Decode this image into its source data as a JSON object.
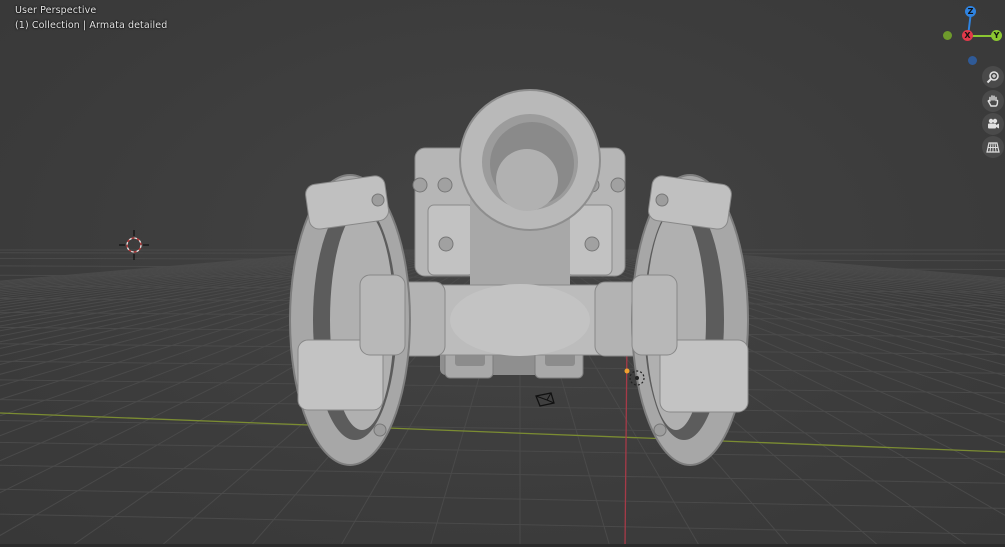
{
  "viewport": {
    "perspective_label": "User Perspective",
    "collection_label": "(1) Collection | Armata detailed"
  },
  "gizmo": {
    "x_label": "X",
    "y_label": "Y",
    "z_label": "Z",
    "colors": {
      "x": "#e0394a",
      "y": "#8bc631",
      "z": "#2f83e0",
      "neg_x": "#7a3a3f",
      "neg_y": "#6e9a2c",
      "neg_z": "#2f5a97"
    }
  },
  "nav_buttons": {
    "zoom_icon": "zoom-icon",
    "pan_icon": "hand-icon",
    "camera_icon": "camera-icon",
    "ortho_icon": "grid-icon"
  },
  "scene": {
    "object_name": "Armata detailed",
    "mesh_color": "#bdbdbd",
    "background_color": "#3d3d3d",
    "x_axis_color": "#7b8c32",
    "y_axis_color": "#a63a48"
  }
}
